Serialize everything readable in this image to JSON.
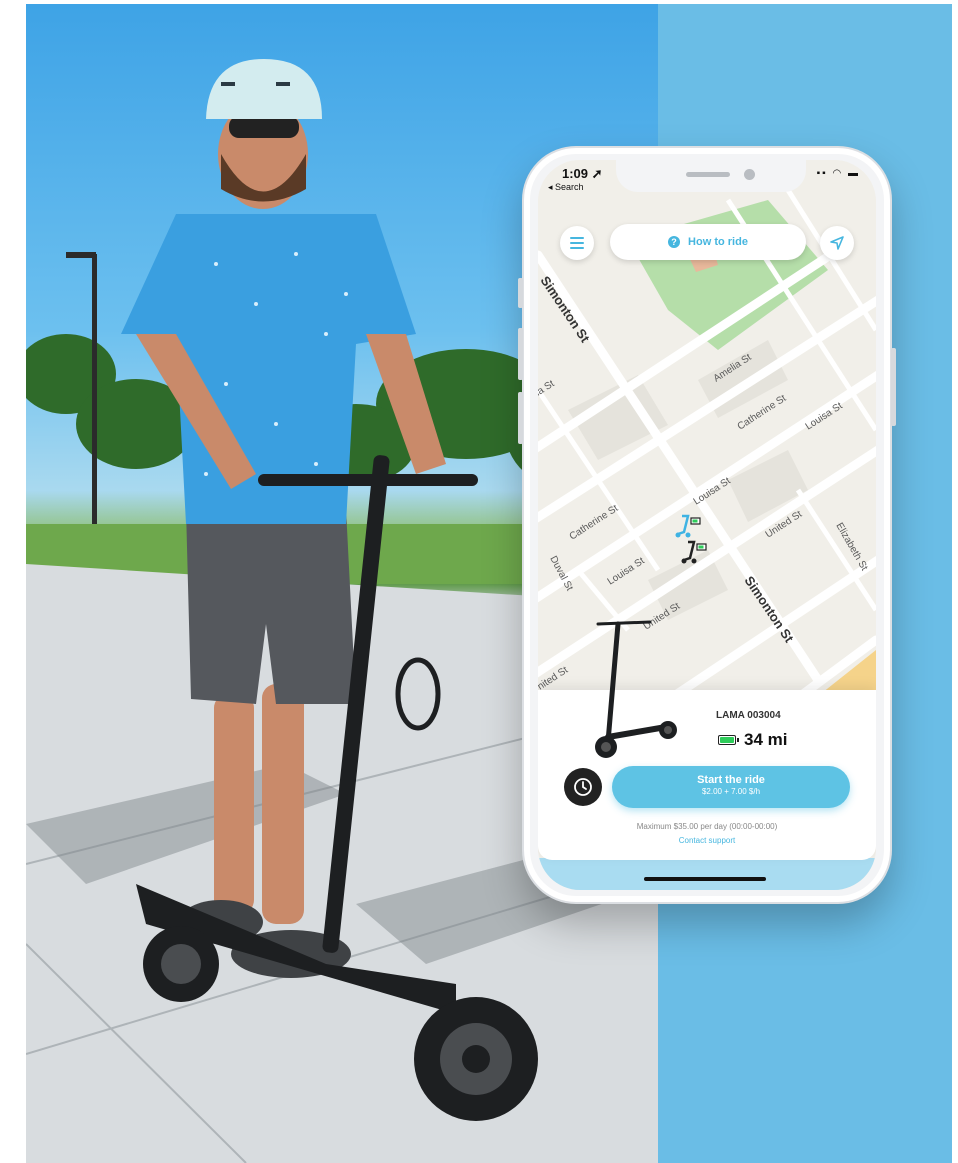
{
  "status_bar": {
    "time": "1:09 ➚",
    "back": "◂ Search",
    "icons": "▪▪ ◠ ▬"
  },
  "top_bar": {
    "menu_icon": "hamburger-menu-icon",
    "how_to_ride": "How to ride",
    "location_icon": "navigation-arrow-icon"
  },
  "map": {
    "streets": [
      "Simonton St",
      "Amelia St",
      "Catherine St",
      "Louisa St",
      "Catherine St",
      "Louisa St",
      "United St",
      "Duval St",
      "Louisa St",
      "United St",
      "Simonton St",
      "Elizabeth St",
      "nited St",
      "ia St"
    ]
  },
  "scooter_panel": {
    "name": "LAMA 003004",
    "range": "34 mi",
    "start_title": "Start the ride",
    "start_price": "$2.00 + 7.00 $/h",
    "max_note": "Maximum $35.00 per day (00:00-00:00)",
    "support": "Contact support",
    "battery_level": 1.0
  },
  "colors": {
    "accent": "#5ec3e4",
    "panel_blue": "#6abde6",
    "battery_green": "#2ecc5a"
  }
}
